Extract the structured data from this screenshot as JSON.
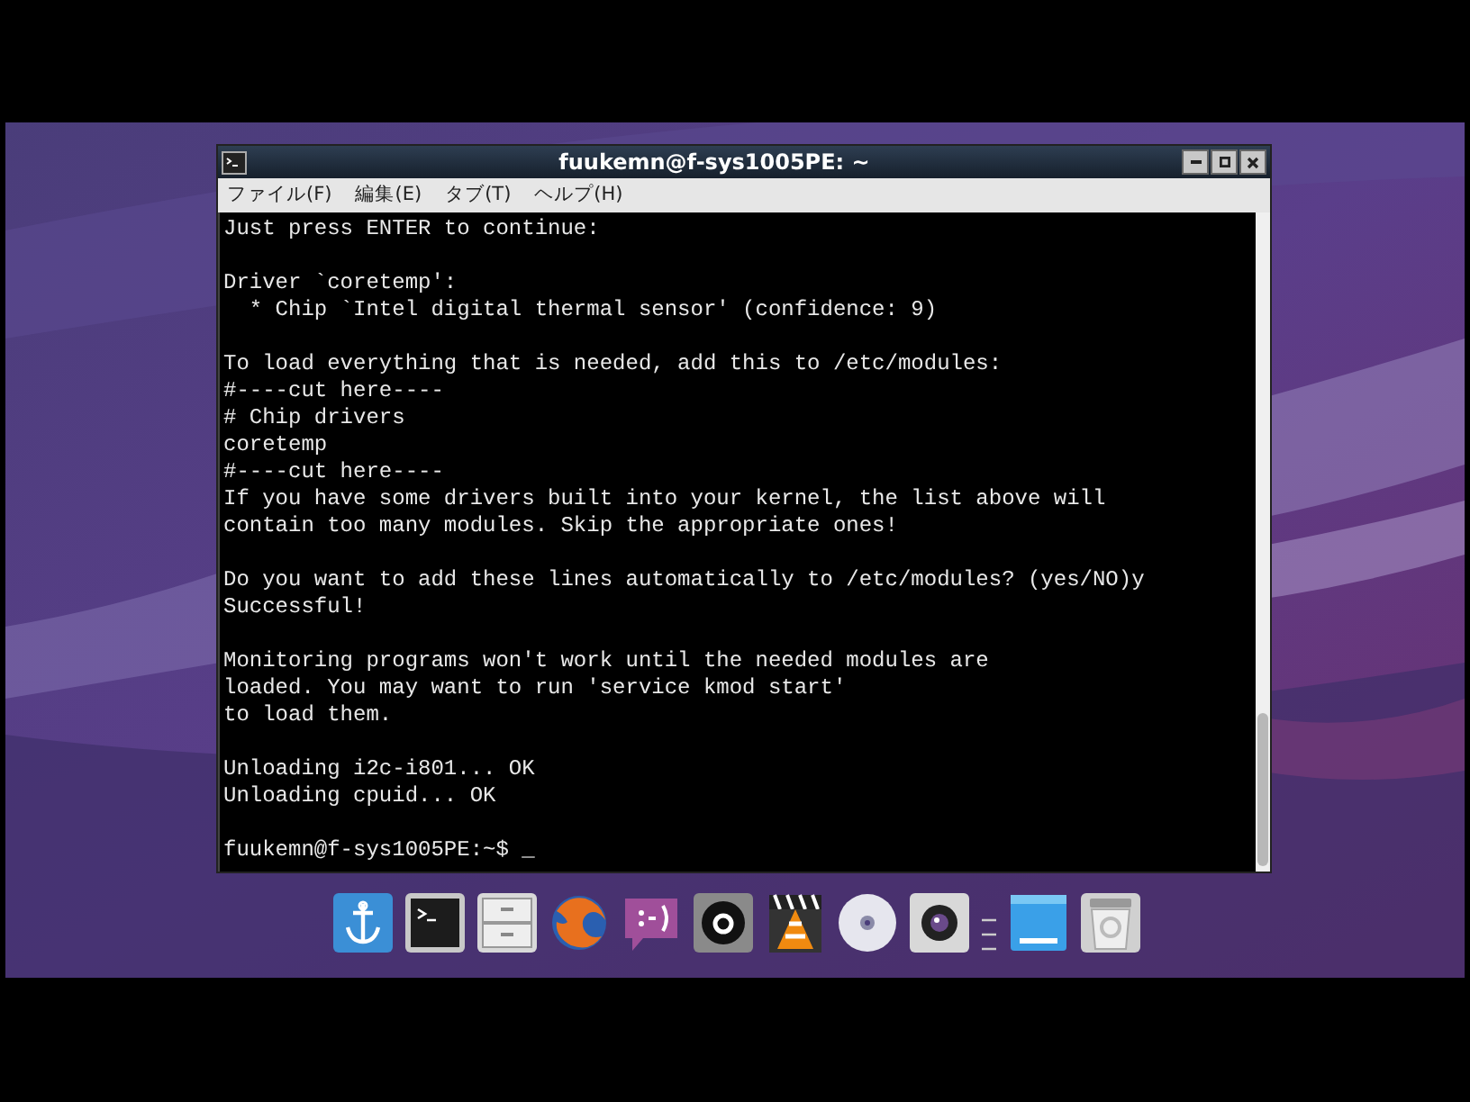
{
  "window": {
    "title": "fuukemn@f-sys1005PE: ~"
  },
  "menu": [
    "ファイル(F)",
    "編集(E)",
    "タブ(T)",
    "ヘルプ(H)"
  ],
  "terminal": {
    "blocks": [
      [
        "Just press ENTER to continue:"
      ],
      [
        "Driver `coretemp':",
        "  * Chip `Intel digital thermal sensor' (confidence: 9)"
      ],
      [
        "To load everything that is needed, add this to /etc/modules:",
        "#----cut here----",
        "# Chip drivers",
        "coretemp",
        "#----cut here----",
        "If you have some drivers built into your kernel, the list above will",
        "contain too many modules. Skip the appropriate ones!"
      ],
      [
        "Do you want to add these lines automatically to /etc/modules? (yes/NO)y",
        "Successful!"
      ],
      [
        "Monitoring programs won't work until the needed modules are",
        "loaded. You may want to run 'service kmod start'",
        "to load them."
      ],
      [
        "Unloading i2c-i801... OK",
        "Unloading cpuid... OK"
      ],
      [
        "fuukemn@f-sys1005PE:~$ _"
      ]
    ]
  },
  "dock": [
    {
      "kind": "anchor"
    },
    {
      "kind": "terminal"
    },
    {
      "kind": "cabinet"
    },
    {
      "kind": "globe"
    },
    {
      "kind": "chat"
    },
    {
      "kind": "circle"
    },
    {
      "kind": "cone"
    },
    {
      "kind": "disc"
    },
    {
      "kind": "camera"
    },
    {
      "kind": "separator"
    },
    {
      "kind": "folder"
    },
    {
      "kind": "trash"
    }
  ]
}
